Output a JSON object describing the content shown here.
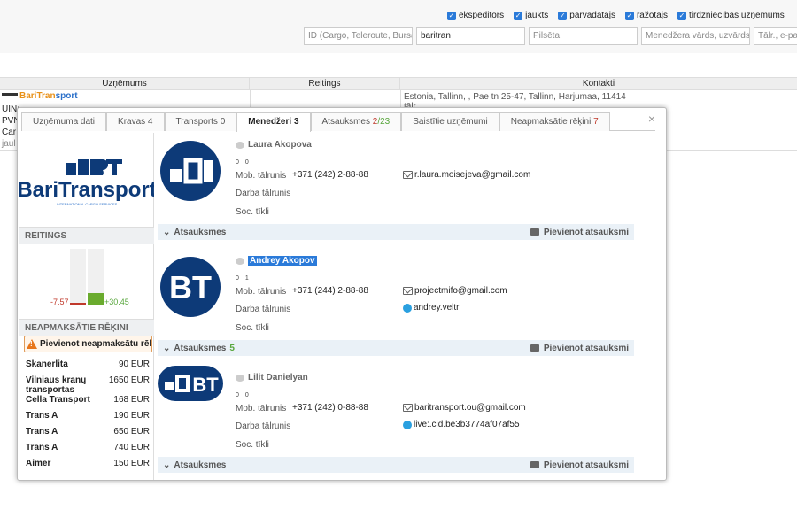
{
  "filters": {
    "checkboxes": [
      {
        "label": "ekspeditors"
      },
      {
        "label": "jaukts"
      },
      {
        "label": "pārvadātājs"
      },
      {
        "label": "ražotājs"
      },
      {
        "label": "tirdzniecības uzņēmums"
      }
    ],
    "id_placeholder": "ID (Cargo, Teleroute, Bursa)",
    "name_value": "baritran",
    "city_placeholder": "Pilsēta",
    "manager_placeholder": "Menedžera vārds, uzvārds",
    "phone_placeholder": "Tālr., e-past"
  },
  "table": {
    "headers": [
      "Uzņēmums",
      "Reitings",
      "Kontakti"
    ],
    "company_a": "BariTran",
    "company_b": "sport",
    "lines": [
      "UIN:",
      "PVN",
      "Car",
      "jaul"
    ],
    "contact_line1": "Estonia, Tallinn, , Pae tn 25-47, Tallinn, Harjumaa, 11414",
    "contact_line2": "tālr"
  },
  "modal": {
    "close": "×",
    "tabs": [
      {
        "label": "Uzņēmuma dati",
        "count": "",
        "extra": ""
      },
      {
        "label": "Kravas 4",
        "count": "",
        "extra": ""
      },
      {
        "label": "Transports 0",
        "count": "",
        "extra": ""
      },
      {
        "label": "Menedžeri 3",
        "count": "",
        "extra": ""
      },
      {
        "label": "Atsauksmes ",
        "count": "2",
        "extra": "/23"
      },
      {
        "label": "Saistītie uzņēmumi",
        "count": "",
        "extra": ""
      },
      {
        "label": "Neapmaksātie rēķini ",
        "count": "7",
        "extra": ""
      }
    ],
    "left": {
      "rating_title": "REITINGS",
      "rating_negative": "-7.57",
      "rating_positive": "+30.45",
      "debts_title": "NEAPMAKSĀTIE RĒĶINI",
      "add_debt": "Pievienot neapmaksātu rēķinu",
      "debts": [
        {
          "name": "Skanerlita",
          "amount": "90 EUR"
        },
        {
          "name": "Vilniaus kranų transportas",
          "amount": "1650 EUR"
        },
        {
          "name": "Cella Transport",
          "amount": "168 EUR"
        },
        {
          "name": "Trans A",
          "amount": "190 EUR"
        },
        {
          "name": "Trans A",
          "amount": "650 EUR"
        },
        {
          "name": "Trans A",
          "amount": "740 EUR"
        },
        {
          "name": "Aimer",
          "amount": "150 EUR"
        }
      ]
    },
    "managers": [
      {
        "name": "Laura Akopova",
        "votes": [
          "0",
          "0"
        ],
        "mobile_label": "Mob. tālrunis",
        "mobile": "+371 (242) 2-88-88",
        "work_label": "Darba tālrunis",
        "social_label": "Soc. tīkli",
        "email": "r.laura.moisejeva@gmail.com",
        "skype": "",
        "feedback": "Atsauksmes",
        "feedback_count": "",
        "add_feedback": "Pievienot atsauksmi"
      },
      {
        "name": "Andrey Akopov",
        "votes": [
          "0",
          "1"
        ],
        "mobile_label": "Mob. tālrunis",
        "mobile": "+371 (244) 2-88-88",
        "work_label": "Darba tālrunis",
        "social_label": "Soc. tīkli",
        "email": "projectmifo@gmail.com",
        "skype": "andrey.veltr",
        "feedback": "Atsauksmes",
        "feedback_count": "5",
        "add_feedback": "Pievienot atsauksmi"
      },
      {
        "name": "Lilit Danielyan",
        "votes": [
          "0",
          "0"
        ],
        "mobile_label": "Mob. tālrunis",
        "mobile": "+371 (242) 0-88-88",
        "work_label": "Darba tālrunis",
        "social_label": "Soc. tīkli",
        "email": "baritransport.ou@gmail.com",
        "skype": "live:.cid.be3b3774af07af55",
        "feedback": "Atsauksmes",
        "feedback_count": "",
        "add_feedback": "Pievienot atsauksmi"
      }
    ],
    "logo_text": "BariTransport",
    "logo_sub": "INTERNATIONAL CARGO SERVICES"
  },
  "colors": {
    "accent": "#2a7ad9",
    "brand_dark": "#0d3a78",
    "negative": "#c0392b",
    "positive": "#58a63c"
  }
}
